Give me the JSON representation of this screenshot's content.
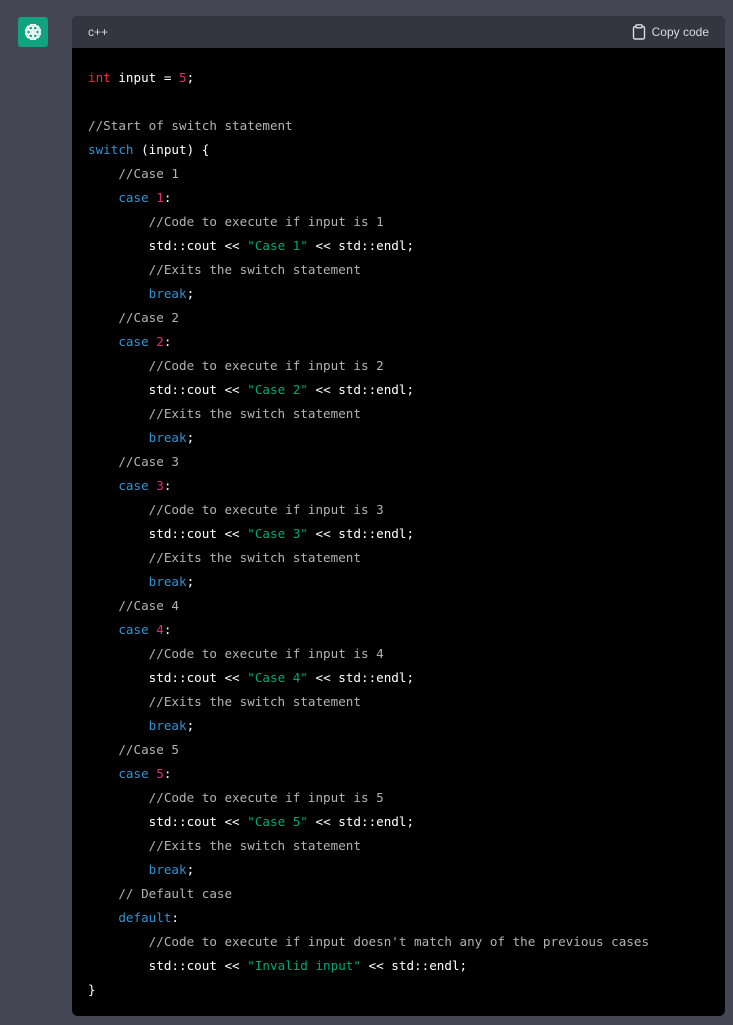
{
  "code_block": {
    "language": "c++",
    "copy_label": "Copy code",
    "lines": [
      [
        {
          "t": "type",
          "v": "int"
        },
        {
          "t": "plain",
          "v": " input = "
        },
        {
          "t": "num",
          "v": "5"
        },
        {
          "t": "plain",
          "v": ";"
        }
      ],
      [],
      [
        {
          "t": "comment",
          "v": "//Start of switch statement"
        }
      ],
      [
        {
          "t": "kw",
          "v": "switch"
        },
        {
          "t": "plain",
          "v": " (input) {"
        }
      ],
      [
        {
          "t": "comment",
          "v": "    //Case 1"
        }
      ],
      [
        {
          "t": "kw",
          "v": "    case "
        },
        {
          "t": "num",
          "v": "1"
        },
        {
          "t": "plain",
          "v": ":"
        }
      ],
      [
        {
          "t": "comment",
          "v": "        //Code to execute if input is 1"
        }
      ],
      [
        {
          "t": "plain",
          "v": "        std::cout << "
        },
        {
          "t": "str",
          "v": "\"Case 1\""
        },
        {
          "t": "plain",
          "v": " << std::endl;"
        }
      ],
      [
        {
          "t": "comment",
          "v": "        //Exits the switch statement"
        }
      ],
      [
        {
          "t": "kw",
          "v": "        break"
        },
        {
          "t": "plain",
          "v": ";"
        }
      ],
      [
        {
          "t": "comment",
          "v": "    //Case 2"
        }
      ],
      [
        {
          "t": "kw",
          "v": "    case "
        },
        {
          "t": "num",
          "v": "2"
        },
        {
          "t": "plain",
          "v": ":"
        }
      ],
      [
        {
          "t": "comment",
          "v": "        //Code to execute if input is 2"
        }
      ],
      [
        {
          "t": "plain",
          "v": "        std::cout << "
        },
        {
          "t": "str",
          "v": "\"Case 2\""
        },
        {
          "t": "plain",
          "v": " << std::endl;"
        }
      ],
      [
        {
          "t": "comment",
          "v": "        //Exits the switch statement"
        }
      ],
      [
        {
          "t": "kw",
          "v": "        break"
        },
        {
          "t": "plain",
          "v": ";"
        }
      ],
      [
        {
          "t": "comment",
          "v": "    //Case 3"
        }
      ],
      [
        {
          "t": "kw",
          "v": "    case "
        },
        {
          "t": "num",
          "v": "3"
        },
        {
          "t": "plain",
          "v": ":"
        }
      ],
      [
        {
          "t": "comment",
          "v": "        //Code to execute if input is 3"
        }
      ],
      [
        {
          "t": "plain",
          "v": "        std::cout << "
        },
        {
          "t": "str",
          "v": "\"Case 3\""
        },
        {
          "t": "plain",
          "v": " << std::endl;"
        }
      ],
      [
        {
          "t": "comment",
          "v": "        //Exits the switch statement"
        }
      ],
      [
        {
          "t": "kw",
          "v": "        break"
        },
        {
          "t": "plain",
          "v": ";"
        }
      ],
      [
        {
          "t": "comment",
          "v": "    //Case 4"
        }
      ],
      [
        {
          "t": "kw",
          "v": "    case "
        },
        {
          "t": "num",
          "v": "4"
        },
        {
          "t": "plain",
          "v": ":"
        }
      ],
      [
        {
          "t": "comment",
          "v": "        //Code to execute if input is 4"
        }
      ],
      [
        {
          "t": "plain",
          "v": "        std::cout << "
        },
        {
          "t": "str",
          "v": "\"Case 4\""
        },
        {
          "t": "plain",
          "v": " << std::endl;"
        }
      ],
      [
        {
          "t": "comment",
          "v": "        //Exits the switch statement"
        }
      ],
      [
        {
          "t": "kw",
          "v": "        break"
        },
        {
          "t": "plain",
          "v": ";"
        }
      ],
      [
        {
          "t": "comment",
          "v": "    //Case 5"
        }
      ],
      [
        {
          "t": "kw",
          "v": "    case "
        },
        {
          "t": "num",
          "v": "5"
        },
        {
          "t": "plain",
          "v": ":"
        }
      ],
      [
        {
          "t": "comment",
          "v": "        //Code to execute if input is 5"
        }
      ],
      [
        {
          "t": "plain",
          "v": "        std::cout << "
        },
        {
          "t": "str",
          "v": "\"Case 5\""
        },
        {
          "t": "plain",
          "v": " << std::endl;"
        }
      ],
      [
        {
          "t": "comment",
          "v": "        //Exits the switch statement"
        }
      ],
      [
        {
          "t": "kw",
          "v": "        break"
        },
        {
          "t": "plain",
          "v": ";"
        }
      ],
      [
        {
          "t": "comment",
          "v": "    // Default case"
        }
      ],
      [
        {
          "t": "kw",
          "v": "    default"
        },
        {
          "t": "plain",
          "v": ":"
        }
      ],
      [
        {
          "t": "comment",
          "v": "        //Code to execute if input doesn't match any of the previous cases"
        }
      ],
      [
        {
          "t": "plain",
          "v": "        std::cout << "
        },
        {
          "t": "str",
          "v": "\"Invalid input\""
        },
        {
          "t": "plain",
          "v": " << std::endl;"
        }
      ],
      [
        {
          "t": "plain",
          "v": "}"
        }
      ]
    ]
  },
  "icons": {
    "avatar": "openai-logo-icon",
    "copy": "clipboard-icon"
  },
  "colors": {
    "background": "#444654",
    "code_bg": "#000000",
    "header_bg": "#343541",
    "type": "#f22c3d",
    "number": "#df3079",
    "keyword": "#2e95d3",
    "string": "#00a67d",
    "comment": "#b3b3b3"
  }
}
